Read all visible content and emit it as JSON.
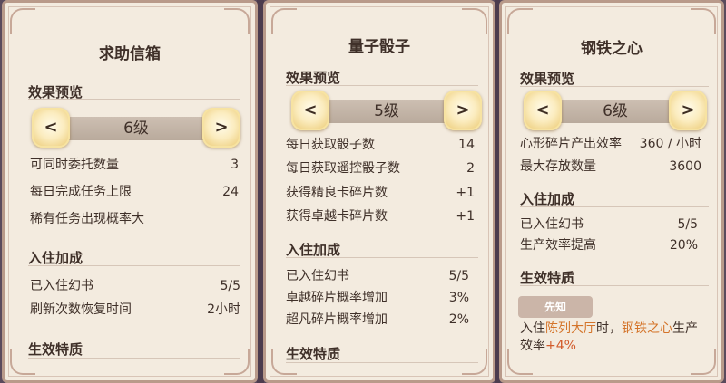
{
  "panels": [
    {
      "title": "求助信箱",
      "preview_label": "效果预览",
      "level": "6级",
      "prev_btn": "<",
      "next_btn": ">",
      "stats": [
        {
          "label": "可同时委托数量",
          "value": "3"
        },
        {
          "label": "每日完成任务上限",
          "value": "24"
        },
        {
          "label": "稀有任务出现概率大",
          "value": ""
        }
      ],
      "bonus_label": "入住加成",
      "bonus": [
        {
          "label": "已入住幻书",
          "value": "5/5"
        },
        {
          "label": "刷新次数恢复时间",
          "value": "2小时"
        }
      ],
      "trait_label": "生效特质"
    },
    {
      "title": "量子骰子",
      "preview_label": "效果预览",
      "level": "5级",
      "prev_btn": "<",
      "next_btn": ">",
      "stats": [
        {
          "label": "每日获取骰子数",
          "value": "14"
        },
        {
          "label": "每日获取遥控骰子数",
          "value": "2"
        },
        {
          "label": "获得精良卡碎片数",
          "value": "+1"
        },
        {
          "label": "获得卓越卡碎片数",
          "value": "+1"
        }
      ],
      "bonus_label": "入住加成",
      "bonus": [
        {
          "label": "已入住幻书",
          "value": "5/5"
        },
        {
          "label": "卓越碎片概率增加",
          "value": "3%"
        },
        {
          "label": "超凡碎片概率增加",
          "value": "2%"
        }
      ],
      "trait_label": "生效特质"
    },
    {
      "title": "钢铁之心",
      "preview_label": "效果预览",
      "level": "6级",
      "prev_btn": "<",
      "next_btn": ">",
      "stats": [
        {
          "label": "心形碎片产出效率",
          "value": "360 / 小时"
        },
        {
          "label": "最大存放数量",
          "value": "3600"
        }
      ],
      "bonus_label": "入住加成",
      "bonus": [
        {
          "label": "已入住幻书",
          "value": "5/5"
        },
        {
          "label": "生产效率提高",
          "value": "20%"
        }
      ],
      "trait_label": "生效特质",
      "trait_tag": "先知",
      "trait_desc": {
        "p1": "入住",
        "loc": "陈列大厅",
        "p2": "时，",
        "target": "钢铁之心",
        "p3": "生产效率",
        "bonus": "+4%"
      }
    }
  ]
}
